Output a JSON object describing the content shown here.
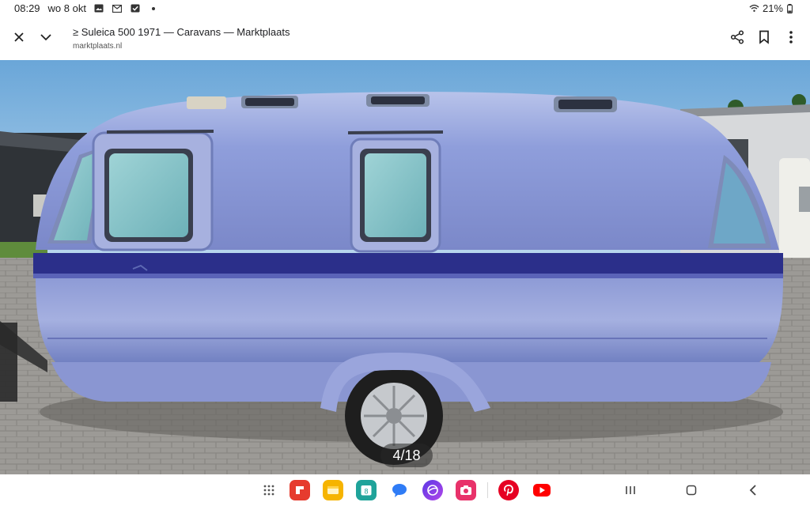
{
  "status_bar": {
    "time": "08:29",
    "date": "wo 8 okt",
    "battery": "21%",
    "icons": [
      "gallery-icon",
      "mail-icon",
      "check-icon",
      "dot-icon",
      "wifi-icon",
      "battery-icon"
    ]
  },
  "browser": {
    "title": "≥ Suleica 500 1971 — Caravans — Marktplaats",
    "domain": "marktplaats.nl",
    "icons": [
      "close-icon",
      "chevron-down-icon",
      "share-icon",
      "bookmark-icon",
      "more-icon"
    ]
  },
  "image_viewer": {
    "counter": "4/18"
  },
  "taskbar": {
    "apps": [
      {
        "name": "apps-grid-icon"
      },
      {
        "name": "flipboard-icon",
        "color": "#e63b2e"
      },
      {
        "name": "notes-icon",
        "color": "#f6b400"
      },
      {
        "name": "calendar-icon",
        "color": "#1fa39a",
        "badge": "8"
      },
      {
        "name": "messages-icon",
        "color": "#2f7cf6"
      },
      {
        "name": "browser-icon",
        "color": "#7a3cf0"
      },
      {
        "name": "camera-app-icon",
        "color": "#e8326a"
      },
      {
        "name": "pinterest-icon",
        "color": "#e60023"
      },
      {
        "name": "youtube-icon",
        "color": "#ff0000"
      }
    ],
    "nav": [
      "recents-icon",
      "home-icon",
      "back-icon"
    ]
  }
}
